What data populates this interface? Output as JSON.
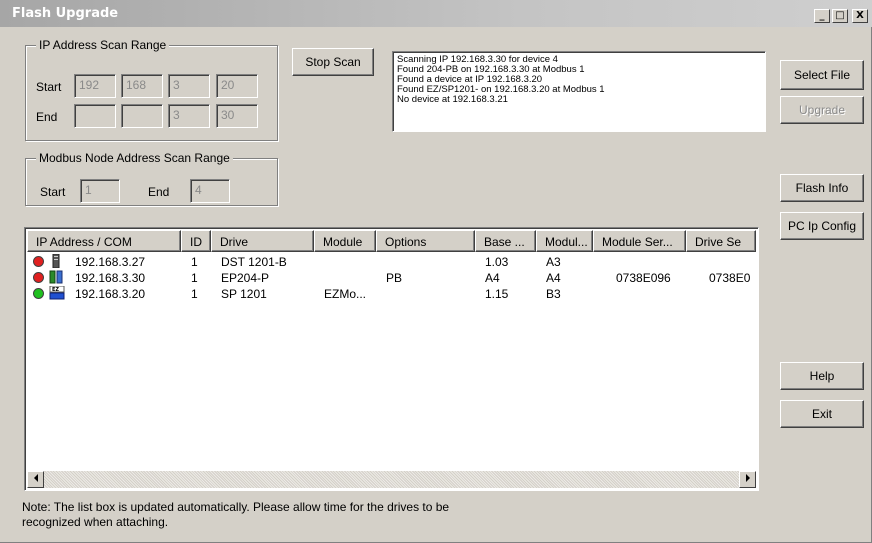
{
  "window": {
    "title": "Flash Upgrade",
    "minimize_label": "_",
    "maximize_label": "□",
    "close_label": "X"
  },
  "ip_range": {
    "legend": "IP Address Scan Range",
    "start_label": "Start",
    "end_label": "End",
    "start": [
      "192",
      "168",
      "3",
      "20"
    ],
    "end": [
      "",
      "",
      "3",
      "30"
    ]
  },
  "modbus_range": {
    "legend": "Modbus Node Address Scan Range",
    "start_label": "Start",
    "start_value": "1",
    "end_label": "End",
    "end_value": "4"
  },
  "buttons": {
    "stop_scan": "Stop Scan",
    "select_file": "Select File",
    "upgrade": "Upgrade",
    "flash_info": "Flash Info",
    "pc_ip_config": "PC Ip Config",
    "help": "Help",
    "exit": "Exit"
  },
  "log_lines": [
    "Scanning IP 192.168.3.30 for device 4",
    "Found 204-PB on 192.168.3.30 at Modbus 1",
    "Found a device at IP 192.168.3.20",
    "Found EZ/SP1201- on 192.168.3.20 at Modbus 1",
    "No device at 192.168.3.21"
  ],
  "list": {
    "columns": [
      "IP Address / COM",
      "ID",
      "Drive",
      "Module",
      "Options",
      "Base ...",
      "Modul...",
      "Module Ser...",
      "Drive Se"
    ],
    "rows": [
      {
        "status_color": "#e02020",
        "icon": "drive-tower-icon",
        "ip": "192.168.3.27",
        "id": "1",
        "drive": "DST 1201-B",
        "module": "",
        "options": "",
        "base": "1.03",
        "modul": "A3",
        "module_ser": "",
        "drive_se": ""
      },
      {
        "status_color": "#e02020",
        "icon": "drive-module-icon",
        "ip": "192.168.3.30",
        "id": "1",
        "drive": "EP204-P",
        "module": "",
        "options": "PB",
        "base": "A4",
        "modul": "A4",
        "module_ser": "0738E096",
        "drive_se": "0738E0"
      },
      {
        "status_color": "#20c020",
        "icon": "ez-drive-icon",
        "ip": "192.168.3.20",
        "id": "1",
        "drive": "SP 1201",
        "module": "EZMo...",
        "options": "",
        "base": "1.15",
        "modul": "B3",
        "module_ser": "",
        "drive_se": ""
      }
    ]
  },
  "note": "Note: The list box is updated automatically.  Please allow time for the drives to be recognized when attaching."
}
